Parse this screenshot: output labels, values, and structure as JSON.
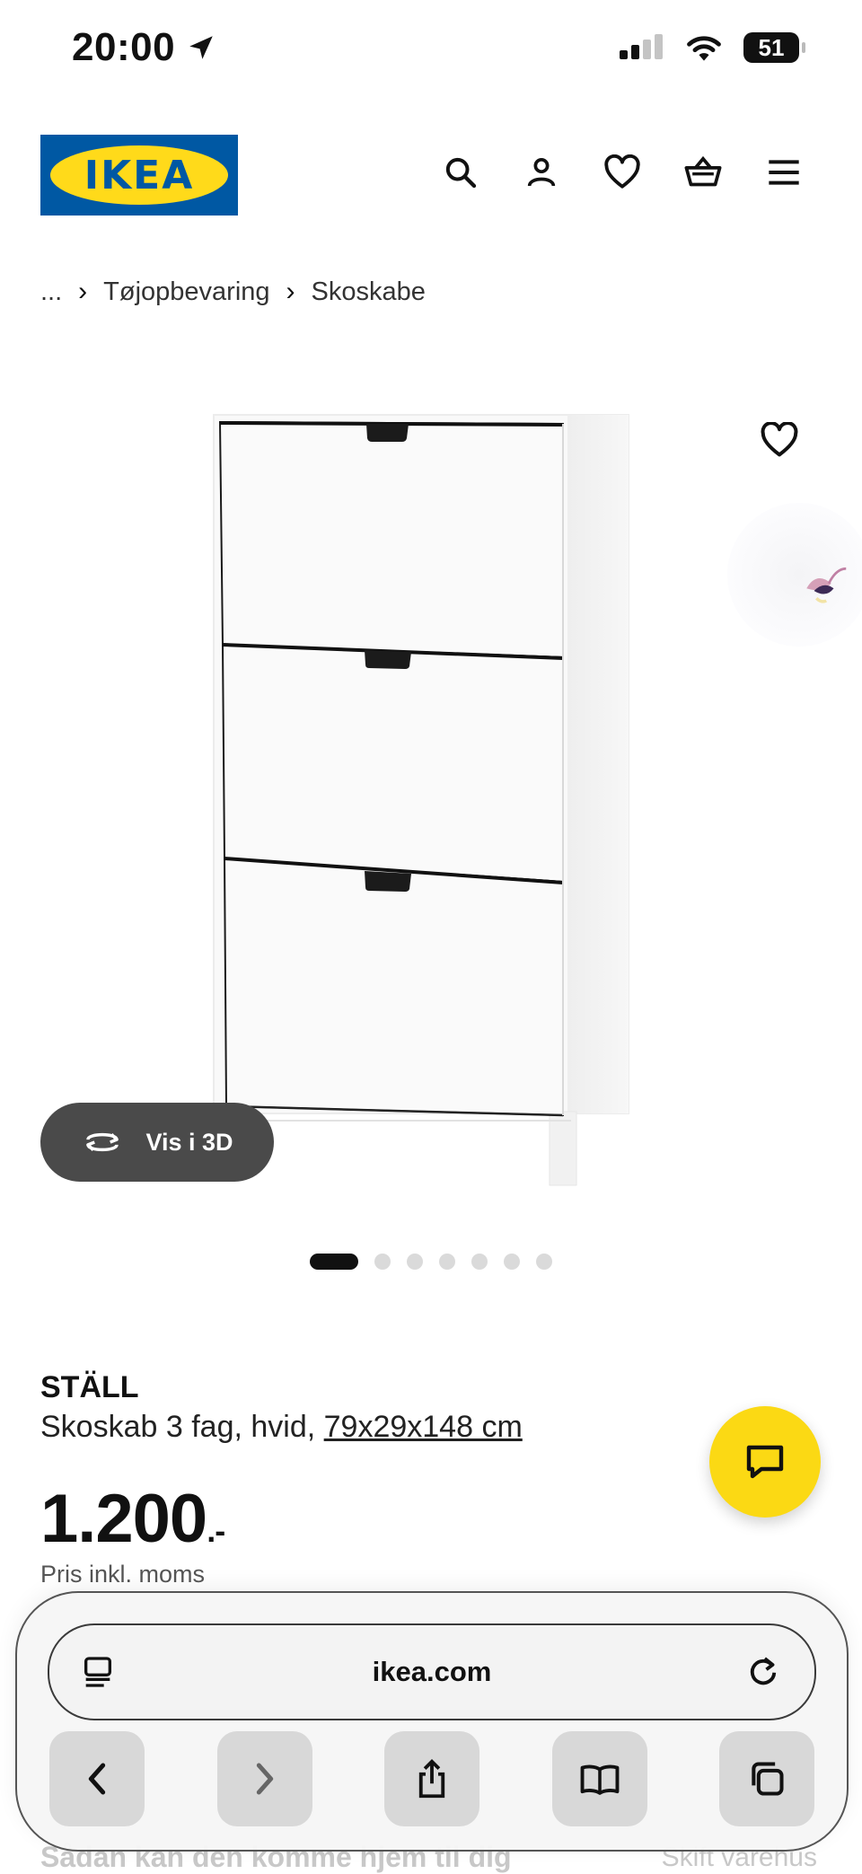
{
  "status_bar": {
    "time": "20:00",
    "battery": "51"
  },
  "header": {
    "logo_text": "IKEA",
    "brand_blue": "#0058a3",
    "brand_yellow": "#ffda1a"
  },
  "breadcrumb": {
    "ellipsis": "...",
    "items": [
      "Tøjopbevaring",
      "Skoskabe"
    ]
  },
  "gallery": {
    "view3d_label": "Vis i 3D",
    "image_count": 7,
    "active_index": 0
  },
  "product": {
    "name": "STÄLL",
    "description": "Skoskab 3 fag, hvid,",
    "dimensions": "79x29x148 cm",
    "price": "1.200",
    "price_suffix": ".-",
    "price_note": "Pris inkl. moms"
  },
  "below_fold": {
    "left": "Sådan kan den komme hjem til dig",
    "right": "Skift varehus"
  },
  "browser": {
    "url": "ikea.com"
  },
  "icons": [
    "location-arrow-icon",
    "signal-icon",
    "wifi-icon",
    "battery-icon",
    "search-icon",
    "account-icon",
    "heart-icon",
    "basket-icon",
    "menu-icon",
    "chevron-right-icon",
    "rotate-3d-icon",
    "chat-icon",
    "reader-icon",
    "reload-icon",
    "back-icon",
    "forward-icon",
    "share-icon",
    "bookmarks-icon",
    "tabs-icon"
  ]
}
